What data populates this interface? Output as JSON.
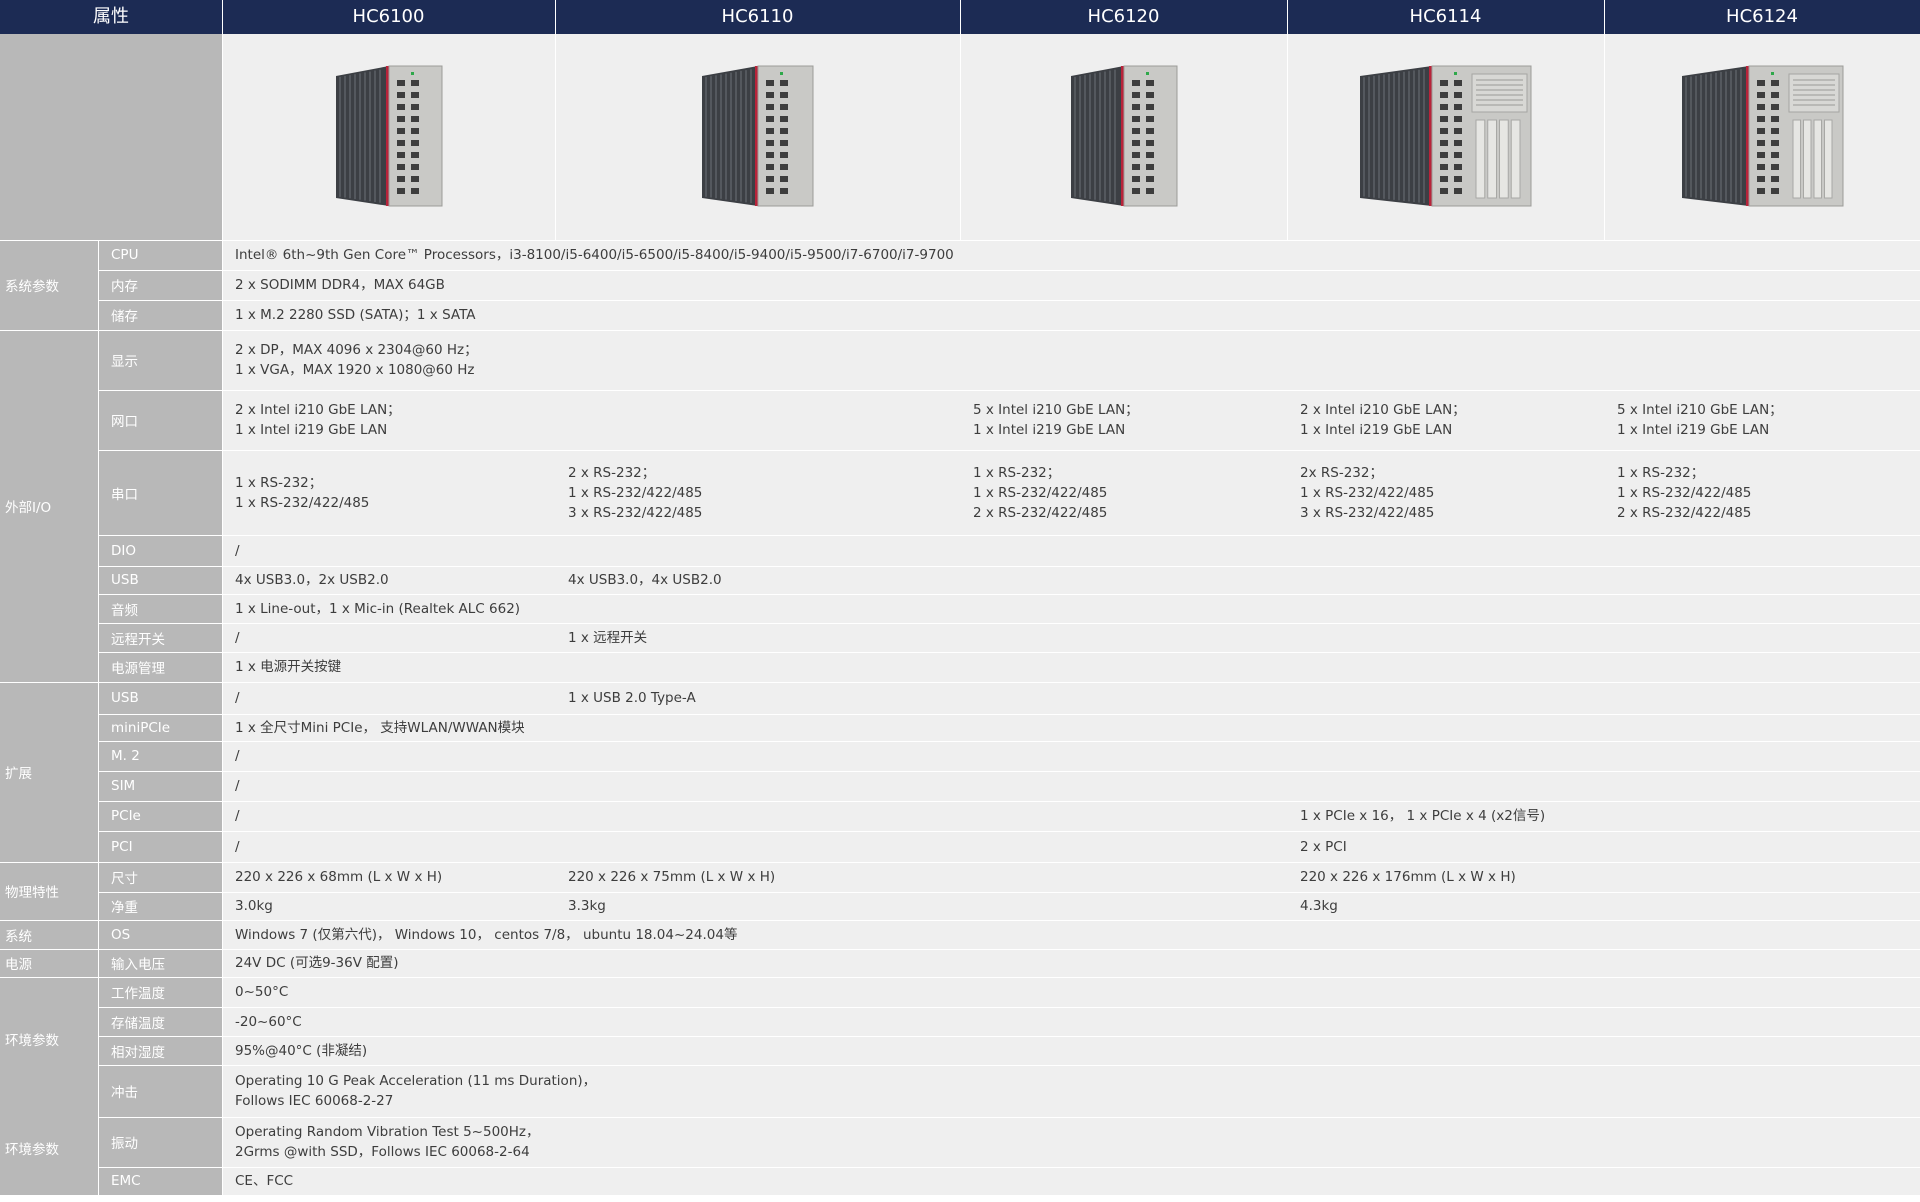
{
  "header": {
    "attr": "属性",
    "models": [
      "HC6100",
      "HC6110",
      "HC6120",
      "HC6114",
      "HC6124"
    ]
  },
  "categories": {
    "system_params": "系统参数",
    "external_io": "外部I/O",
    "expansion": "扩展",
    "physical": "物理特性",
    "os_group": "系统",
    "power_group": "电源",
    "env_params_1": "环境参数",
    "env_params_2": "环境参数"
  },
  "labels": {
    "cpu": "CPU",
    "memory": "内存",
    "storage": "储存",
    "display": "显示",
    "lan": "网口",
    "serial": "串口",
    "dio": "DIO",
    "usb_io": "USB",
    "audio": "音频",
    "remote_switch": "远程开关",
    "power_mgmt": "电源管理",
    "usb_ext": "USB",
    "minipcie": "miniPCIe",
    "m2": "M. 2",
    "sim": "SIM",
    "pcie": "PCIe",
    "pci": "PCI",
    "size": "尺寸",
    "weight": "净重",
    "os": "OS",
    "input_voltage": "输入电压",
    "op_temp": "工作温度",
    "storage_temp": "存储温度",
    "humidity": "相对湿度",
    "shock": "冲击",
    "vibration": "振动",
    "emc": "EMC"
  },
  "values": {
    "cpu": "Intel® 6th~9th Gen Core™ Processors，i3-8100/i5-6400/i5-6500/i5-8400/i5-9400/i5-9500/i7-6700/i7-9700",
    "memory": "2 x SODIMM DDR4，MAX 64GB",
    "storage": "1 x M.2 2280 SSD (SATA)；1 x SATA",
    "display": [
      "2 x DP，MAX 4096 x 2304@60 Hz；",
      "1 x VGA，MAX 1920 x 1080@60 Hz"
    ],
    "lan_a": [
      "2 x Intel i210 GbE LAN；",
      "1 x Intel i219 GbE LAN"
    ],
    "lan_b": [
      "5 x Intel i210 GbE LAN；",
      "1 x Intel i219 GbE LAN"
    ],
    "lan_c": [
      "2 x Intel i210 GbE LAN；",
      "1 x Intel i219 GbE LAN"
    ],
    "lan_d": [
      "5 x Intel i210 GbE LAN；",
      "1 x Intel i219 GbE LAN"
    ],
    "serial_hc6100": [
      "1 x RS-232；",
      "1 x RS-232/422/485"
    ],
    "serial_hc6110": [
      "2 x RS-232；",
      "1 x RS-232/422/485",
      "3 x RS-232/422/485"
    ],
    "serial_hc6120": [
      "1 x RS-232；",
      "1 x RS-232/422/485",
      "2 x RS-232/422/485"
    ],
    "serial_hc6114": [
      "2x RS-232；",
      "1 x RS-232/422/485",
      "3 x RS-232/422/485"
    ],
    "serial_hc6124": [
      "1 x RS-232；",
      "1 x RS-232/422/485",
      "2 x RS-232/422/485"
    ],
    "dio": "/",
    "usb_io_a": "4x USB3.0，2x USB2.0",
    "usb_io_b": "4x USB3.0，4x USB2.0",
    "audio": "1 x Line-out，1 x Mic-in (Realtek ALC 662)",
    "remote_switch_a": "/",
    "remote_switch_b": "1 x 远程开关",
    "power_mgmt": "1 x 电源开关按键",
    "usb_ext_a": "/",
    "usb_ext_b": "1 x USB 2.0 Type-A",
    "minipcie": "1 x 全尺寸Mini PCIe， 支持WLAN/WWAN模块",
    "m2": "/",
    "sim": "/",
    "pcie_a": "/",
    "pcie_b": "1 x PCIe x 16， 1 x PCIe x 4 (x2信号)",
    "pci_a": "/",
    "pci_b": "2 x PCI",
    "size_a": "220 x 226 x 68mm (L x W x H)",
    "size_b": "220 x 226 x 75mm (L x W x H)",
    "size_c": "220 x 226 x 176mm (L x W x H)",
    "weight_a": "3.0kg",
    "weight_b": "3.3kg",
    "weight_c": "4.3kg",
    "os": "Windows 7 (仅第六代)， Windows 10， centos 7/8， ubuntu 18.04~24.04等",
    "input_voltage": "24V DC (可选9-36V 配置)",
    "op_temp": "0~50°C",
    "storage_temp": "-20~60°C",
    "humidity": "95%@40°C (非凝结)",
    "shock": [
      "Operating 10 G Peak Acceleration (11 ms Duration)，",
      "Follows IEC 60068-2-27"
    ],
    "vibration": [
      "Operating Random Vibration Test 5~500Hz，",
      "2Grms @with SSD，Follows IEC 60068-2-64"
    ],
    "emc": "CE、FCC"
  },
  "product_images": [
    "industrial-pc-hc6100",
    "industrial-pc-hc6110",
    "industrial-pc-hc6120",
    "industrial-pc-hc6114",
    "industrial-pc-hc6124"
  ],
  "colors": {
    "header_bg": "#1c2b54",
    "label_bg": "#b8b8b8",
    "cell_bg": "#efefef"
  }
}
